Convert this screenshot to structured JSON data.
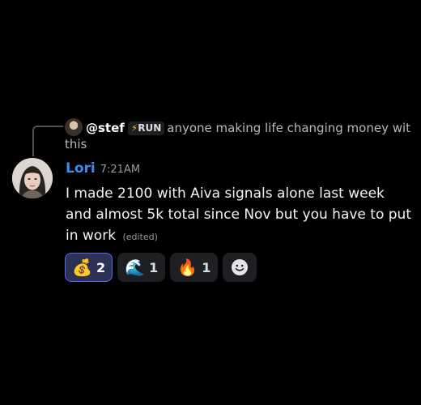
{
  "reply": {
    "username": "@stef",
    "tag_icon": "⚡",
    "tag_label": "RUN",
    "text_line1": "anyone making life changing money wit",
    "text_line2": "this"
  },
  "message": {
    "username": "Lori",
    "timestamp": "7:21AM",
    "text": "I made 2100 with Aiva signals alone last week and almost 5k total since Nov but you have to put in work",
    "edited_label": "(edited)"
  },
  "reactions": [
    {
      "emoji": "💰",
      "icon": "money-bag-icon",
      "count": "2",
      "active": true
    },
    {
      "emoji": "🌊",
      "icon": "wave-icon",
      "count": "1",
      "active": false
    },
    {
      "emoji": "🔥",
      "icon": "fire-icon",
      "count": "1",
      "active": false
    }
  ],
  "add_reaction": {
    "icon": "smiley-add-reaction-icon"
  },
  "colors": {
    "background": "#000000",
    "username": "#3b8bf0",
    "active_reaction_bg": "#2d3254",
    "active_reaction_border": "#5865f2"
  }
}
